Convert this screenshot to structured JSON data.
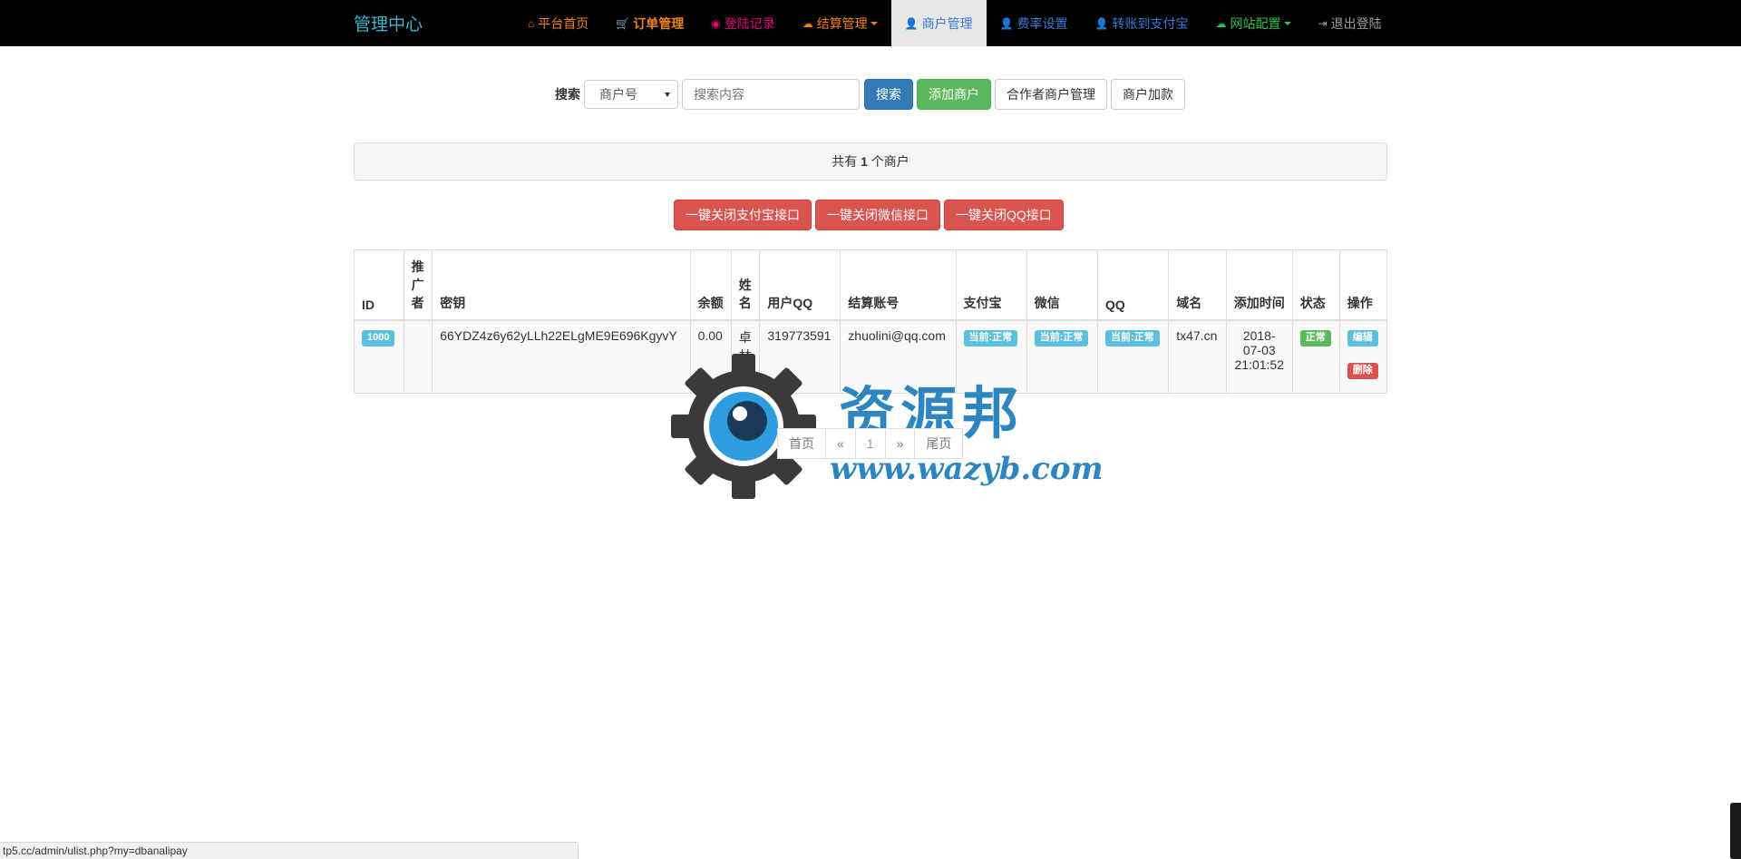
{
  "navbar": {
    "brand": "管理中心",
    "items": [
      {
        "label": "平台首页",
        "icon": "home-icon",
        "color": "#f0811a",
        "bold": false,
        "caret": false,
        "active": false
      },
      {
        "label": "订单管理",
        "icon": "cart-icon",
        "color": "#f0811a",
        "bold": true,
        "caret": false,
        "active": false
      },
      {
        "label": "登陆记录",
        "icon": "camera-icon",
        "color": "#e4007f",
        "bold": false,
        "caret": false,
        "active": false
      },
      {
        "label": "结算管理",
        "icon": "cloud-icon",
        "color": "#f0811a",
        "bold": false,
        "caret": true,
        "active": false
      },
      {
        "label": "商户管理",
        "icon": "user-icon",
        "color": "#3a7ad0",
        "bold": false,
        "caret": false,
        "active": true
      },
      {
        "label": "费率设置",
        "icon": "user-icon",
        "color": "#3a7ad0",
        "bold": false,
        "caret": false,
        "active": false
      },
      {
        "label": "转账到支付宝",
        "icon": "user-icon",
        "color": "#3a7ad0",
        "bold": false,
        "caret": false,
        "active": false
      },
      {
        "label": "网站配置",
        "icon": "cloud-icon",
        "color": "#32c14a",
        "bold": false,
        "caret": true,
        "active": false
      },
      {
        "label": "退出登陆",
        "icon": "logout-icon",
        "color": "#9d9d9d",
        "bold": false,
        "caret": false,
        "active": false
      }
    ]
  },
  "search": {
    "label": "搜索",
    "select_value": "商户号",
    "placeholder": "搜索内容",
    "search_button": "搜索",
    "add_button": "添加商户",
    "partner_button": "合作者商户管理",
    "add_funds_button": "商户加款"
  },
  "summary": {
    "prefix": "共有",
    "count": "1",
    "suffix": "个商户"
  },
  "bulk_actions": {
    "close_alipay": "一键关闭支付宝接口",
    "close_wechat": "一键关闭微信接口",
    "close_qq": "一键关闭QQ接口"
  },
  "table": {
    "headers": [
      "ID",
      "推广者",
      "密钥",
      "余额",
      "姓名",
      "用户QQ",
      "结算账号",
      "支付宝",
      "微信",
      "QQ",
      "域名",
      "添加时间",
      "状态",
      "操作"
    ],
    "rows": [
      {
        "id": "1000",
        "promoter": "",
        "key": "66YDZ4z6y62yLLh22ELgME9E696KgyvY",
        "balance": "0.00",
        "name": "卓林",
        "qq": "319773591",
        "account": "zhuolini@qq.com",
        "alipay": "当前:正常",
        "wechat": "当前:正常",
        "qqpay": "当前:正常",
        "domain": "tx47.cn",
        "date": "2018-07-03",
        "time": "21:01:52",
        "status": "正常",
        "edit": "编辑",
        "delete": "删除"
      }
    ]
  },
  "pagination": {
    "first": "首页",
    "prev": "«",
    "current": "1",
    "next": "»",
    "last": "尾页"
  },
  "watermark": {
    "cn": "资源邦",
    "en": "www.wazyb.com"
  },
  "statusbar": {
    "url": "tp5.cc/admin/ulist.php?my=dbanalipay"
  }
}
